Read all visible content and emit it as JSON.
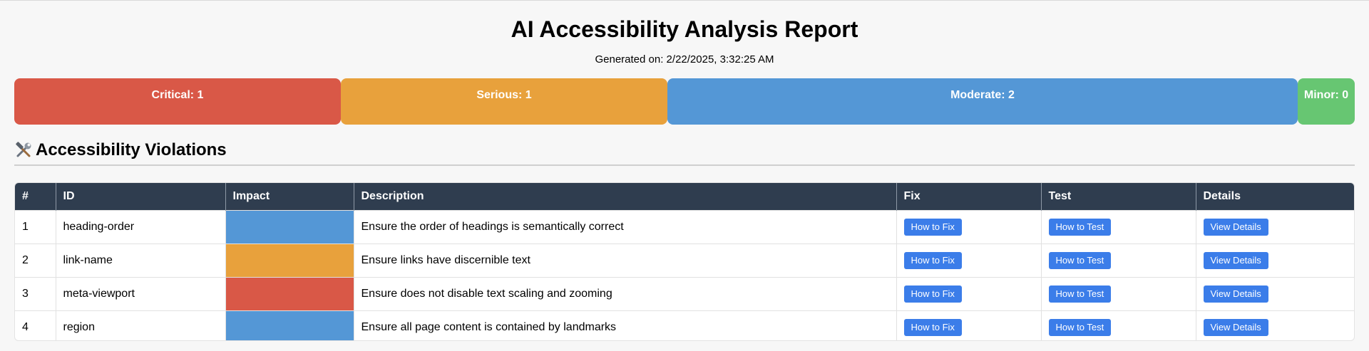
{
  "header": {
    "title": "AI Accessibility Analysis Report",
    "generated": "Generated on: 2/22/2025, 3:32:25 AM"
  },
  "summary": [
    {
      "label": "Critical: 1",
      "color": "#d95847"
    },
    {
      "label": "Serious: 1",
      "color": "#e8a13c"
    },
    {
      "label": "Moderate: 2",
      "color": "#5497d6"
    },
    {
      "label": "Minor: 0",
      "color": "#67c672"
    }
  ],
  "section": {
    "icon": "hammer-and-wrench-icon",
    "title": "Accessibility Violations"
  },
  "table": {
    "headers": [
      "#",
      "ID",
      "Impact",
      "Description",
      "Fix",
      "Test",
      "Details"
    ],
    "rows": [
      {
        "num": "1",
        "id": "heading-order",
        "impact_color": "#5497d6",
        "description": "Ensure the order of headings is semantically correct",
        "fix": "How to Fix",
        "test": "How to Test",
        "details": "View Details"
      },
      {
        "num": "2",
        "id": "link-name",
        "impact_color": "#e8a13c",
        "description": "Ensure links have discernible text",
        "fix": "How to Fix",
        "test": "How to Test",
        "details": "View Details"
      },
      {
        "num": "3",
        "id": "meta-viewport",
        "impact_color": "#d95847",
        "description": "Ensure does not disable text scaling and zooming",
        "fix": "How to Fix",
        "test": "How to Test",
        "details": "View Details"
      },
      {
        "num": "4",
        "id": "region",
        "impact_color": "#5497d6",
        "description": "Ensure all page content is contained by landmarks",
        "fix": "How to Fix",
        "test": "How to Test",
        "details": "View Details"
      }
    ]
  },
  "colors": {
    "header_bg": "#2f3d4f",
    "button": "#3b7de9"
  }
}
